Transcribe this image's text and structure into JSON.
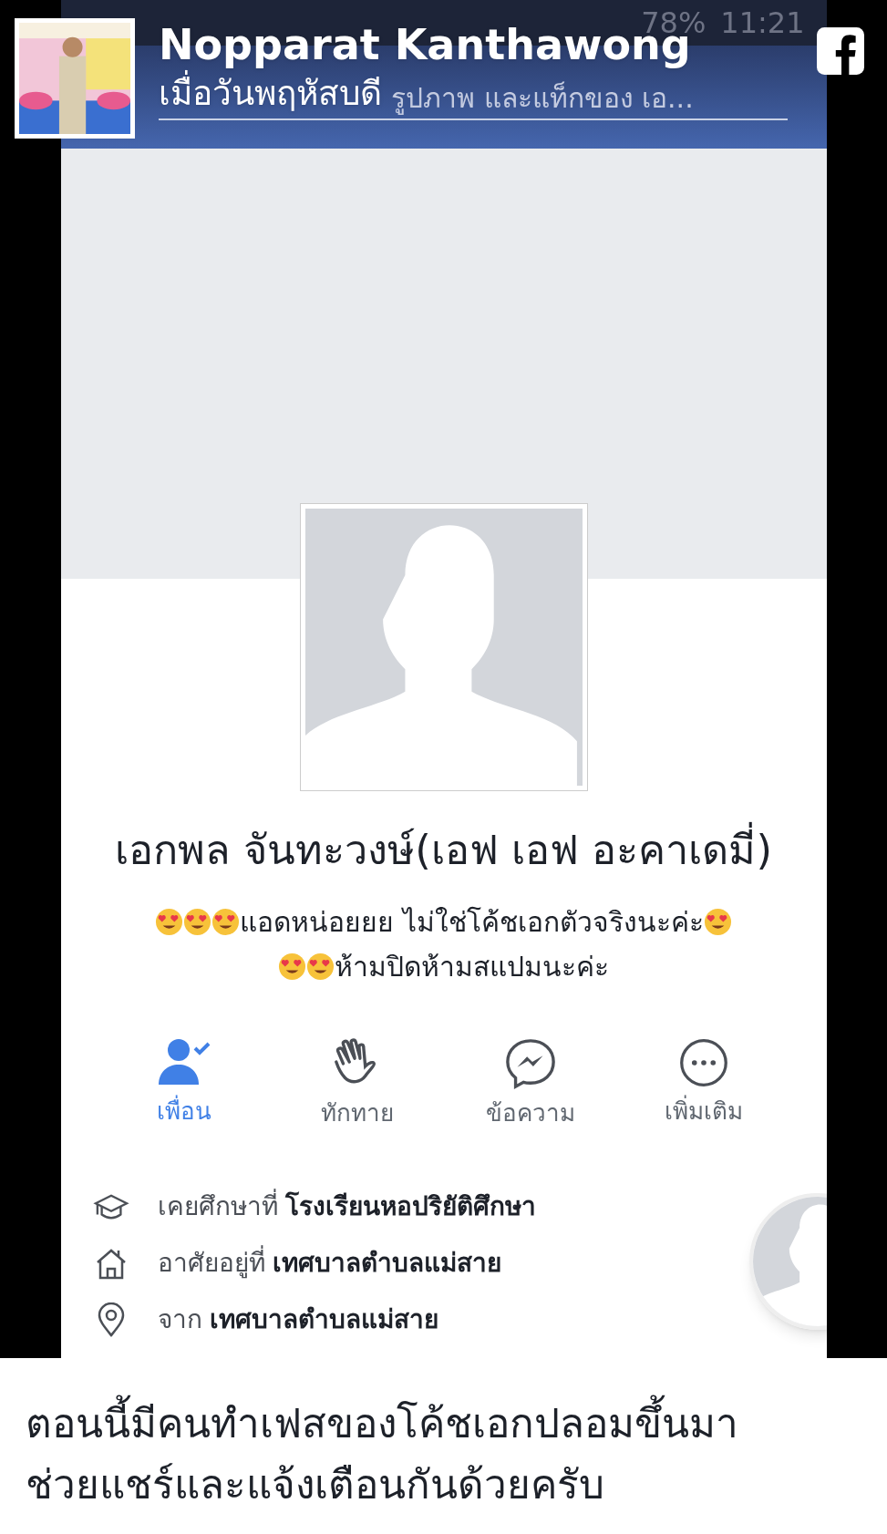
{
  "status_bar": {
    "battery": "78%",
    "time": "11:21"
  },
  "overlay": {
    "author": "Nopparat Kanthawong",
    "time": "เมื่อวันพฤหัสบดี",
    "behind_text": "รูปภาพ และแท็กของ เอ..."
  },
  "profile": {
    "name": "เอกพล จันทะวงษ์(เอฟ เอฟ อะคาเดมี่)",
    "bio_lines": [
      [
        {
          "kind": "emoji"
        },
        {
          "kind": "emoji"
        },
        {
          "kind": "emoji"
        },
        {
          "kind": "text",
          "text": "แอดหน่อยยย ไม่ใช่โค้ชเอกตัวจริงนะค่ะ"
        },
        {
          "kind": "emoji"
        }
      ],
      [
        {
          "kind": "emoji"
        },
        {
          "kind": "emoji"
        },
        {
          "kind": "text",
          "text": "ห้ามปิดห้ามสแปมนะค่ะ"
        }
      ]
    ]
  },
  "actions": [
    {
      "kind": "friend",
      "label": "เพื่อน",
      "selected": true
    },
    {
      "kind": "wave",
      "label": "ทักทาย",
      "selected": false
    },
    {
      "kind": "message",
      "label": "ข้อความ",
      "selected": false
    },
    {
      "kind": "more",
      "label": "เพิ่มเติม",
      "selected": false
    }
  ],
  "details": [
    {
      "kind": "school",
      "text": "เคยศึกษาที่ **โรงเรียนหอปริยัติศึกษา**"
    },
    {
      "kind": "home",
      "text": "อาศัยอยู่ที่ **เทศบาลตำบลแม่สาย**"
    },
    {
      "kind": "location",
      "text": "จาก **เทศบาลตำบลแม่สาย**"
    }
  ],
  "caption": [
    "ตอนนี้มีคนทำเฟสของโค้ชเอกปลอมขึ้นมา",
    "ช่วยแชร์และแจ้งเตือนกันด้วยครับ"
  ]
}
